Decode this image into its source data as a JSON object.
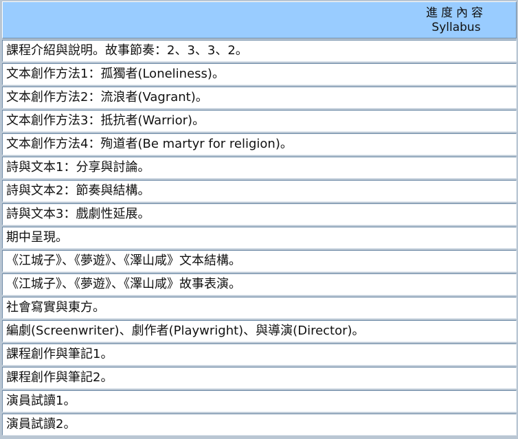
{
  "header": {
    "title_zh": "進度內容",
    "title_en": "Syllabus"
  },
  "rows": [
    "課程介紹與說明。故事節奏：2、3、3、2。",
    "文本創作方法1：孤獨者(Loneliness)。",
    "文本創作方法2：流浪者(Vagrant)。",
    "文本創作方法3：抵抗者(Warrior)。",
    "文本創作方法4：殉道者(Be martyr for religion)。",
    "詩與文本1：分享與討論。",
    "詩與文本2：節奏與結構。",
    "詩與文本3：戲劇性延展。",
    "期中呈現。",
    "《江城子》、《夢遊》、《澤山咸》文本結構。",
    "《江城子》、《夢遊》、《澤山咸》故事表演。",
    "社會寫實與東方。",
    "編劇(Screenwriter)、劇作者(Playwright)、與導演(Director)。",
    "課程創作與筆記1。",
    "課程創作與筆記2。",
    "演員試讀1。",
    "演員試讀2。"
  ]
}
